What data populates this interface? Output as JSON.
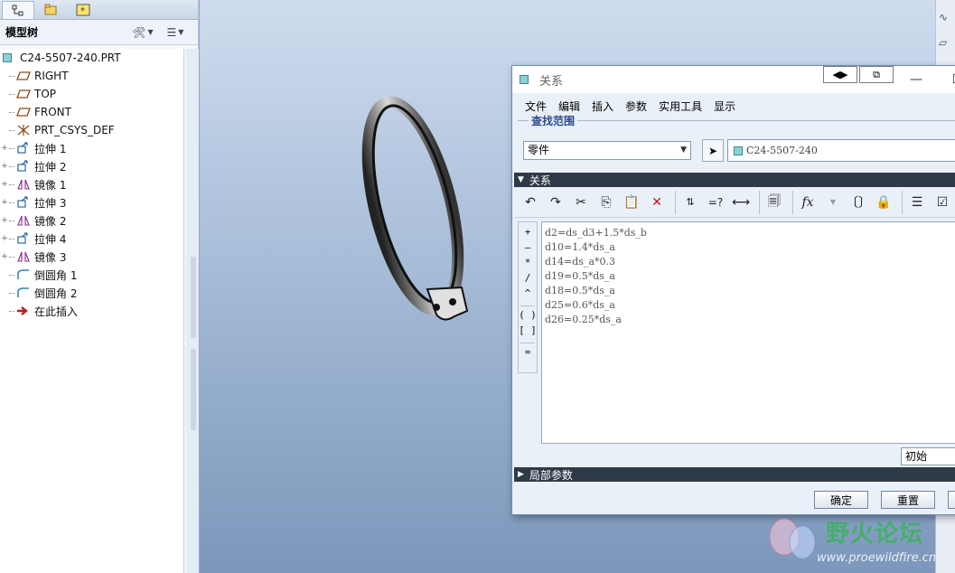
{
  "model_tree": {
    "title": "模型树",
    "root": "C24-5507-240.PRT",
    "items": [
      {
        "label": "RIGHT",
        "icon": "datum-plane-icon",
        "expandable": false
      },
      {
        "label": "TOP",
        "icon": "datum-plane-icon",
        "expandable": false
      },
      {
        "label": "FRONT",
        "icon": "datum-plane-icon",
        "expandable": false
      },
      {
        "label": "PRT_CSYS_DEF",
        "icon": "csys-icon",
        "expandable": false
      },
      {
        "label": "拉伸 1",
        "icon": "extrude-icon",
        "expandable": true
      },
      {
        "label": "拉伸 2",
        "icon": "extrude-icon",
        "expandable": true
      },
      {
        "label": "镜像 1",
        "icon": "mirror-icon",
        "expandable": true
      },
      {
        "label": "拉伸 3",
        "icon": "extrude-icon",
        "expandable": true
      },
      {
        "label": "镜像 2",
        "icon": "mirror-icon",
        "expandable": true
      },
      {
        "label": "拉伸 4",
        "icon": "extrude-icon",
        "expandable": true
      },
      {
        "label": "镜像 3",
        "icon": "mirror-icon",
        "expandable": true
      },
      {
        "label": "倒圆角 1",
        "icon": "round-icon",
        "expandable": false
      },
      {
        "label": "倒圆角 2",
        "icon": "round-icon",
        "expandable": false
      },
      {
        "label": "在此插入",
        "icon": "insert-here-arrow-icon",
        "expandable": false
      }
    ]
  },
  "dialog": {
    "title": "关系",
    "menu": [
      "文件",
      "编辑",
      "插入",
      "参数",
      "实用工具",
      "显示"
    ],
    "scope_label": "查找范围",
    "scope_value": "零件",
    "part_name": "C24-5507-240",
    "relations_section": "关系",
    "relations": [
      "d2=ds_d3+1.5*ds_b",
      "d10=1.4*ds_a",
      "d14=ds_a*0.3",
      "d19=0.5*ds_a",
      "d18=0.5*ds_a",
      "d25=0.6*ds_a",
      "d26=0.25*ds_a"
    ],
    "operators": [
      "+",
      "–",
      "*",
      "/",
      "^",
      "( )",
      "[ ]",
      "="
    ],
    "sort_value": "初始",
    "local_params_section": "局部参数",
    "ok_label": "确定",
    "reset_label": "重置"
  },
  "watermark": {
    "name": "野火论坛",
    "url": "www.proewildfire.cn"
  },
  "colors": {
    "section_bar": "#2f3a48",
    "scope_label": "#2a4d8f",
    "watermark_green": "#32b450"
  }
}
